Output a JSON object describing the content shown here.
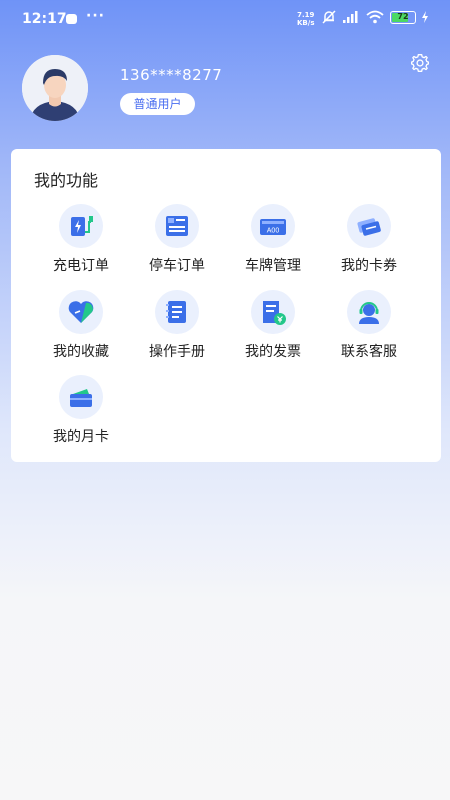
{
  "status_bar": {
    "time": "12:17",
    "dots": "···",
    "net_speed_value": "7.19",
    "net_speed_unit": "KB/s",
    "battery": "72"
  },
  "profile": {
    "phone": "136****8277",
    "user_type": "普通用户"
  },
  "functions": {
    "title": "我的功能",
    "items": [
      {
        "label": "充电订单",
        "icon": "charging-order-icon"
      },
      {
        "label": "停车订单",
        "icon": "parking-order-icon"
      },
      {
        "label": "车牌管理",
        "icon": "license-plate-icon"
      },
      {
        "label": "我的卡券",
        "icon": "coupon-icon"
      },
      {
        "label": "我的收藏",
        "icon": "favorite-icon"
      },
      {
        "label": "操作手册",
        "icon": "manual-icon"
      },
      {
        "label": "我的发票",
        "icon": "invoice-icon"
      },
      {
        "label": "联系客服",
        "icon": "customer-service-icon"
      },
      {
        "label": "我的月卡",
        "icon": "monthly-card-icon"
      }
    ]
  },
  "plate_icon_text": "A00",
  "colors": {
    "accent": "#4a6ef0",
    "icon_blue": "#3b6fe8",
    "icon_green": "#23c78a",
    "icon_bg": "#eaf0fd"
  }
}
